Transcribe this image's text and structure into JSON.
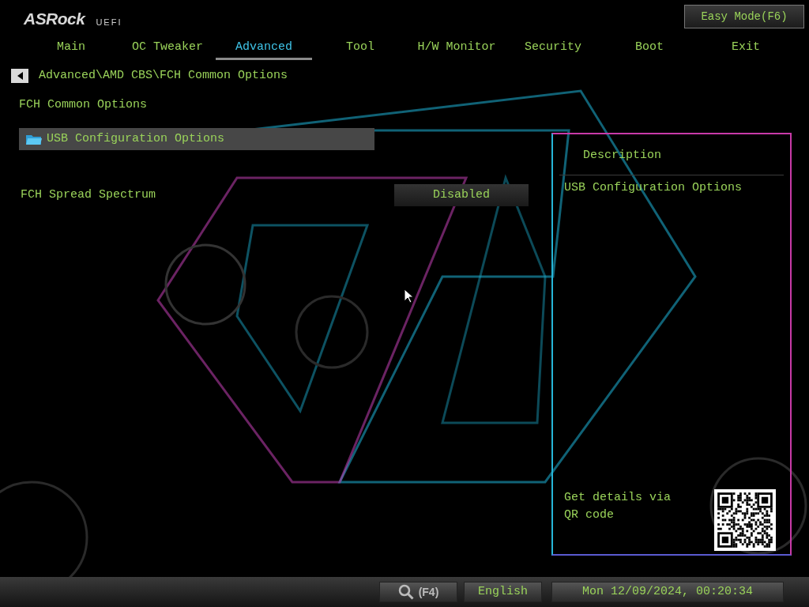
{
  "header": {
    "logo": "ASRock",
    "logo_suffix": "UEFI",
    "easy_mode_button": "Easy Mode(F6)"
  },
  "tabs": [
    {
      "label": "Main",
      "selected": false
    },
    {
      "label": "OC Tweaker",
      "selected": false
    },
    {
      "label": "Advanced",
      "selected": true
    },
    {
      "label": "Tool",
      "selected": false
    },
    {
      "label": "H/W Monitor",
      "selected": false
    },
    {
      "label": "Security",
      "selected": false
    },
    {
      "label": "Boot",
      "selected": false
    },
    {
      "label": "Exit",
      "selected": false
    }
  ],
  "breadcrumb": "Advanced\\AMD CBS\\FCH Common Options",
  "section_title": "FCH Common Options",
  "items": [
    {
      "kind": "submenu",
      "label": "USB Configuration Options",
      "selected": true
    },
    {
      "kind": "option",
      "label": "FCH Spread Spectrum",
      "value": "Disabled",
      "selected": false
    }
  ],
  "description": {
    "title": "Description",
    "text": "USB Configuration Options",
    "qr_hint": "Get details via QR code"
  },
  "status_bar": {
    "search_key": "(F4)",
    "language": "English",
    "datetime": "Mon 12/09/2024, 00:20:34"
  }
}
